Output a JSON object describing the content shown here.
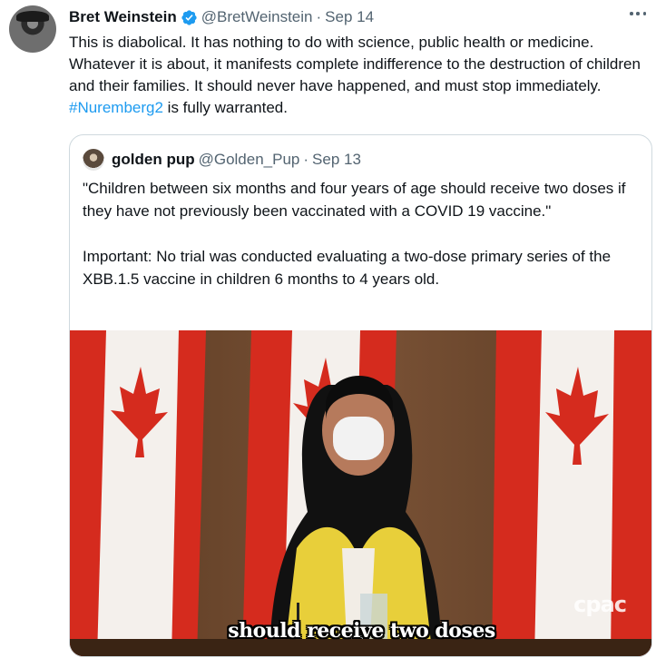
{
  "tweet": {
    "author_name": "Bret Weinstein",
    "author_handle": "@BretWeinstein",
    "separator": "·",
    "date": "Sep 14",
    "text_before_tag": "This is diabolical. It has nothing to do with science, public health or medicine. Whatever it is about, it manifests  complete indifference to the destruction of children and their families. It should never have happened, and must stop immediately. ",
    "hashtag": "#Nuremberg2",
    "text_after_tag": " is fully warranted.",
    "verified_icon": "verified-badge-icon",
    "more_icon": "more-options-icon"
  },
  "quoted": {
    "author_name": "golden pup",
    "author_handle": "@Golden_Pup",
    "separator": "·",
    "date": "Sep 13",
    "paragraph_1": "\"Children between six months and four years of age should receive two doses if they have not previously been vaccinated with a COVID 19 vaccine.\"",
    "paragraph_2": "Important: No trial was conducted evaluating a two-dose primary series of the XBB.1.5 vaccine in children 6 months to 4 years old.",
    "media": {
      "caption": "should receive two doses",
      "watermark": "cpac"
    }
  },
  "colors": {
    "text": "#0f1419",
    "secondary": "#536471",
    "link": "#1d9bf0",
    "border": "#cfd9de",
    "flag_red": "#d52b1e"
  }
}
